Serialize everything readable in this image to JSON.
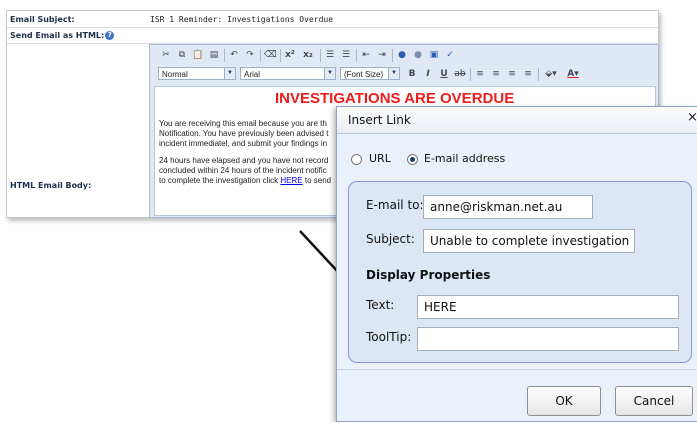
{
  "form": {
    "email_subject_label": "Email Subject:",
    "email_subject_value": "ISR 1 Reminder: Investigations Overdue",
    "send_html_label": "Send Email as HTML:",
    "send_html_checked": "✓",
    "html_body_label": "HTML Email Body:"
  },
  "toolbar": {
    "format_value": "Normal",
    "font_value": "Arial",
    "size_value": "(Font Size)"
  },
  "editor": {
    "title": "INVESTIGATIONS ARE OVERDUE",
    "line1": "You are receiving this email because you are th",
    "line2": "Notification. You have previously been advised t",
    "line3": "incident immediatel, and submit your findings in",
    "line4": "24 hours have elapsed and you have not record",
    "line5": "concluded within 24 hours of the incident notific",
    "line6_prefix": "to complete the investigation click ",
    "line6_link": "HERE",
    "line6_suffix": " to send"
  },
  "dialog": {
    "title": "Insert Link",
    "close": "×",
    "radio_url": "URL",
    "radio_email": "E-mail address",
    "email_to_label": "E-mail to:",
    "email_to_value": "anne@riskman.net.au",
    "subject_label": "Subject:",
    "subject_value": "Unable to complete investigation",
    "display_heading": "Display Properties",
    "text_label": "Text:",
    "text_value": "HERE",
    "tooltip_label": "ToolTip:",
    "tooltip_value": "",
    "ok_label": "OK",
    "cancel_label": "Cancel"
  },
  "colors": {
    "title_red": "#ee1c1c",
    "dialog_bg": "#eaf1fa",
    "fieldset_bg": "#dce7f6",
    "link_blue": "#0000ee"
  }
}
